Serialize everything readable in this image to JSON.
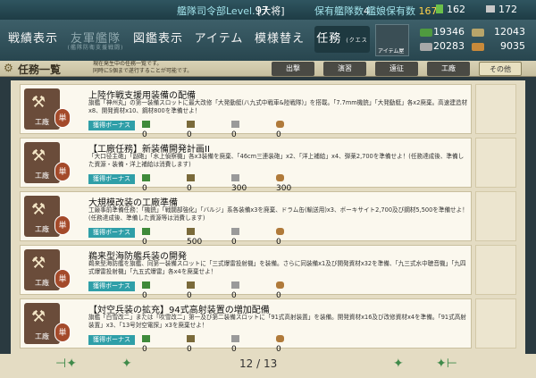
{
  "top": {
    "hq_label": "艦隊司令部Level.",
    "hq_level": "97",
    "rank": "[大将]",
    "ship_count_label": "保有艦隊数",
    "ship_count": "4",
    "equip_label": "艦娘保有数",
    "equip_count": "167",
    "res_top_left": "162",
    "res_top_right": "172"
  },
  "nav": {
    "items": [
      {
        "label": "戦績表示"
      },
      {
        "label": "友軍艦隊",
        "sub": "(艦隊防衛支援戦闘)"
      },
      {
        "label": "図鑑表示"
      },
      {
        "label": "アイテム"
      },
      {
        "label": "模様替え"
      },
      {
        "label": "任務",
        "sub": "(クエスト)"
      }
    ],
    "item_shop": "アイテム屋"
  },
  "resources": {
    "fuel": "19346",
    "ammo": "12043",
    "steel": "20283",
    "bauxite": "9035"
  },
  "quest_header": {
    "title": "任務一覧",
    "desc_line1": "現在発生中の任務一覧です。",
    "desc_line2": "同時に5個まで遂行することが可能です。",
    "tabs": [
      {
        "label": "出撃"
      },
      {
        "label": "演習"
      },
      {
        "label": "遠征"
      },
      {
        "label": "工廠"
      },
      {
        "label": "その他"
      }
    ]
  },
  "quests": [
    {
      "badge": "工廠",
      "seal": "単",
      "title": "上陸作戦支援用装備の配備",
      "desc": "旗艦「神州丸」の第一装備スロットに最大改修「大発動艇(八九式中戦車&陸戦隊)」を搭載。「7.7mm機銃」「大発動艇」各x2廃棄。高速建造材x8、開発資材x10、鋼材800を準備せよ！",
      "bonus": "獲得ボーナス",
      "rewards": [
        "0",
        "0",
        "0",
        "0"
      ]
    },
    {
      "badge": "工廠",
      "seal": "単",
      "title": "【工廠任務】新装備開発計画II",
      "desc": "「大口径主砲」「副砲」「水上偵察機」各x3装備を廃棄、「46cm三連装砲」x2、「洋上補給」x4、弾薬2,700を準備せよ！(任務達成後、準備した資源・装備・洋上補給は消費します)",
      "bonus": "獲得ボーナス",
      "rewards": [
        "0",
        "0",
        "300",
        "300"
      ]
    },
    {
      "badge": "工廠",
      "seal": "単",
      "title": "大規模改装の工廠準備",
      "desc": "工廠事前準備任務：「機銃」「戦闘部強化」「バルジ」系各装備x3を廃棄、ドラム缶(輸送用)x3、ボーキサイト2,700及び鋼材5,500を準備せよ！(任務達成後、準備した資源等は消費します)",
      "bonus": "獲得ボーナス",
      "rewards": [
        "0",
        "500",
        "0",
        "0"
      ]
    },
    {
      "badge": "工廠",
      "seal": "単",
      "title": "鵜来型海防艦兵装の開発",
      "desc": "鵜来型海防艦を旗艦、同第一装備スロットに「三式爆雷投射機」を装備。さらに同装備x1及び開発資材x32を準備、「九三式水中聴音機」「九四式爆雷投射機」「九五式爆雷」各x4を廃棄せよ！",
      "bonus": "獲得ボーナス",
      "rewards": [
        "0",
        "0",
        "0",
        "0"
      ]
    },
    {
      "badge": "工廠",
      "seal": "単",
      "title": "【対空兵装の拡充】94式高射装置の増加配備",
      "desc": "旗艦「白雪改二」または「吹雪改二」第一及び第二装備スロットに「91式高射装置」を装備。開発資材x16及び改修資材x4を準備。「91式高射装置」x3、「13号対空電探」x3を廃棄せよ！",
      "bonus": "獲得ボーナス",
      "rewards": [
        "0",
        "0",
        "0",
        "0"
      ]
    }
  ],
  "pager": {
    "current": "12",
    "separator": "/",
    "total": "13"
  }
}
